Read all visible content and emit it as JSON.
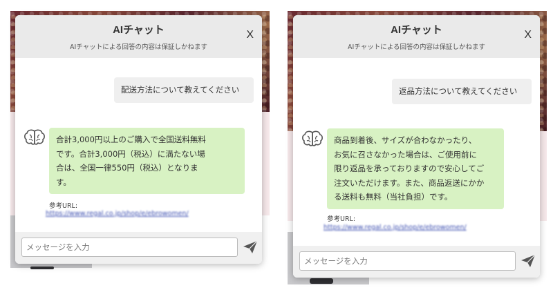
{
  "chat": {
    "title": "AIチャット",
    "subtitle": "AIチャットによる回答の内容は保証しかねます",
    "close_label": "X",
    "reference_label": "参考URL:",
    "input_placeholder": "メッセージを入力"
  },
  "conversations": [
    {
      "user_message": "配送方法について教えてください",
      "bot_reply_lines": [
        "合計3,000円以上のご購入で全国送料無料",
        "です。合計3,000円（税込）に満たない場",
        "合は、全国一律550円（税込）となりま",
        "す。"
      ],
      "reference_url": "https://www.regal.co.jp/shop/e/ebrowomen/"
    },
    {
      "user_message": "返品方法について教えてください",
      "bot_reply_lines": [
        "商品到着後、サイズが合わなかったり、",
        "お気に召さなかった場合は、ご使用前に",
        "限り返品を承っておりますので安心してご",
        "注文いただけます。また、商品返送にかか",
        "る送料も無料（当社負担）です。"
      ],
      "reference_url": "https://www.regal.co.jp/shop/e/ebrowomen/"
    }
  ],
  "icons": {
    "bot_avatar": "brain-icon",
    "send": "paper-plane-icon"
  },
  "colors": {
    "header_bg": "#eaeaea",
    "user_bubble": "#efefef",
    "bot_bubble": "#d8f2c3",
    "link": "#3d4fb0",
    "input_bar": "#f0f0f0"
  }
}
